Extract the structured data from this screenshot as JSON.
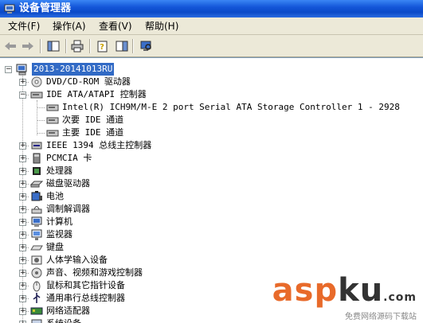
{
  "window": {
    "title": "设备管理器"
  },
  "menu": [
    {
      "label": "文件(F)"
    },
    {
      "label": "操作(A)"
    },
    {
      "label": "查看(V)"
    },
    {
      "label": "帮助(H)"
    }
  ],
  "tree": {
    "root": "2013-20141013RU",
    "items": [
      {
        "label": "DVD/CD-ROM 驱动器",
        "icon": "cdrom-icon",
        "expanded": false
      },
      {
        "label": "IDE ATA/ATAPI 控制器",
        "icon": "ide-controller-icon",
        "expanded": true,
        "children": [
          {
            "label": "Intel(R) ICH9M/M-E 2 port Serial ATA Storage Controller 1 - 2928"
          },
          {
            "label": "次要 IDE 通道"
          },
          {
            "label": "主要 IDE 通道"
          }
        ]
      },
      {
        "label": "IEEE 1394 总线主控制器",
        "icon": "ieee1394-icon",
        "expanded": false
      },
      {
        "label": "PCMCIA 卡",
        "icon": "pcmcia-icon",
        "expanded": false
      },
      {
        "label": "处理器",
        "icon": "processor-icon",
        "expanded": false
      },
      {
        "label": "磁盘驱动器",
        "icon": "disk-drive-icon",
        "expanded": false
      },
      {
        "label": "电池",
        "icon": "battery-icon",
        "expanded": false
      },
      {
        "label": "调制解调器",
        "icon": "modem-icon",
        "expanded": false
      },
      {
        "label": "计算机",
        "icon": "computer-icon",
        "expanded": false
      },
      {
        "label": "监视器",
        "icon": "monitor-icon",
        "expanded": false
      },
      {
        "label": "键盘",
        "icon": "keyboard-icon",
        "expanded": false
      },
      {
        "label": "人体学输入设备",
        "icon": "hid-icon",
        "expanded": false
      },
      {
        "label": "声音、视频和游戏控制器",
        "icon": "sound-icon",
        "expanded": false
      },
      {
        "label": "鼠标和其它指针设备",
        "icon": "mouse-icon",
        "expanded": false
      },
      {
        "label": "通用串行总线控制器",
        "icon": "usb-icon",
        "expanded": false
      },
      {
        "label": "网络适配器",
        "icon": "network-adapter-icon",
        "expanded": false
      },
      {
        "label": "系统设备",
        "icon": "system-device-icon",
        "expanded": false
      }
    ]
  },
  "watermark": {
    "brand_a": "asp",
    "brand_b": "ku",
    "brand_c": ".com",
    "sub": "免费网络源码下载站"
  }
}
